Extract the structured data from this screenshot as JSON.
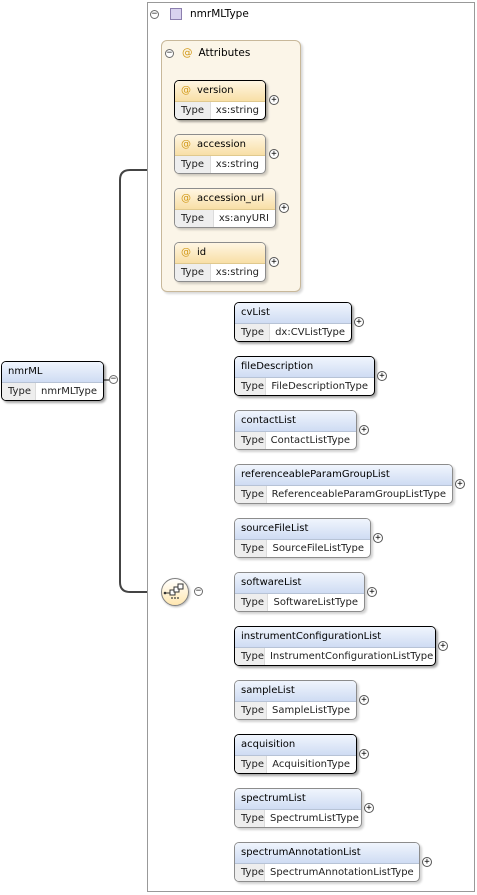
{
  "root": {
    "name": "nmrML",
    "type_label": "Type",
    "type_value": "nmrMLType"
  },
  "complex_type": {
    "title": "nmrMLType"
  },
  "attributes": {
    "title": "Attributes",
    "items": [
      {
        "name": "version",
        "type_label": "Type",
        "type_value": "xs:string",
        "required": true
      },
      {
        "name": "accession",
        "type_label": "Type",
        "type_value": "xs:string",
        "required": false
      },
      {
        "name": "accession_url",
        "type_label": "Type",
        "type_value": "xs:anyURI",
        "required": false
      },
      {
        "name": "id",
        "type_label": "Type",
        "type_value": "xs:string",
        "required": false
      }
    ]
  },
  "elements": [
    {
      "name": "cvList",
      "type_label": "Type",
      "type_value": "dx:CVListType",
      "required": true
    },
    {
      "name": "fileDescription",
      "type_label": "Type",
      "type_value": "FileDescriptionType",
      "required": true
    },
    {
      "name": "contactList",
      "type_label": "Type",
      "type_value": "ContactListType",
      "required": false
    },
    {
      "name": "referenceableParamGroupList",
      "type_label": "Type",
      "type_value": "ReferenceableParamGroupListType",
      "required": false
    },
    {
      "name": "sourceFileList",
      "type_label": "Type",
      "type_value": "SourceFileListType",
      "required": false
    },
    {
      "name": "softwareList",
      "type_label": "Type",
      "type_value": "SoftwareListType",
      "required": false
    },
    {
      "name": "instrumentConfigurationList",
      "type_label": "Type",
      "type_value": "InstrumentConfigurationListType",
      "required": true
    },
    {
      "name": "sampleList",
      "type_label": "Type",
      "type_value": "SampleListType",
      "required": false
    },
    {
      "name": "acquisition",
      "type_label": "Type",
      "type_value": "AcquisitionType",
      "required": true
    },
    {
      "name": "spectrumList",
      "type_label": "Type",
      "type_value": "SpectrumListType",
      "required": false
    },
    {
      "name": "spectrumAnnotationList",
      "type_label": "Type",
      "type_value": "SpectrumAnnotationListType",
      "required": false
    }
  ],
  "icons": {
    "collapse": "minus-circle-icon",
    "expand": "plus-circle-icon",
    "attribute": "at-sign-icon",
    "sequence": "sequence-compositor-icon",
    "complex_type": "complex-type-icon"
  },
  "colors": {
    "element_header": "#cfdcf3",
    "attribute_header": "#f8dfa6",
    "attribute_group_bg": "#fbf5e8",
    "connector": "#555555"
  }
}
